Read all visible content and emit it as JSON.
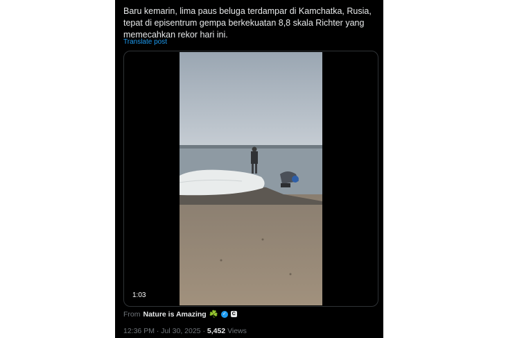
{
  "post": {
    "text": "Baru kemarin, lima paus beluga terdampar di Kamchatka, Rusia, tepat di episentrum gempa berkekuatan 8,8 skala Richter yang memecahkan rekor hari ini.",
    "translate_label": "Translate post"
  },
  "media": {
    "duration": "1:03"
  },
  "source": {
    "prefix": "From",
    "name": "Nature is Amazing",
    "emoji": "☘️",
    "verified_icon": "verified-badge-icon",
    "affiliate_icon": "affiliate-badge-icon",
    "affiliate_letter": "C"
  },
  "meta": {
    "time": "12:36 PM",
    "separator": "·",
    "date": "Jul 30, 2025",
    "views_count": "5,452",
    "views_label": "Views"
  }
}
